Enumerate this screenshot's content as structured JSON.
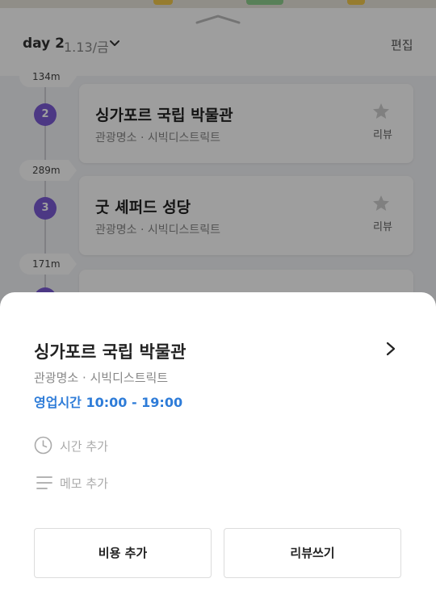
{
  "colors": {
    "accent_purple": "#7b5bd6",
    "hours_blue": "#2e7cd8",
    "overlay": "rgba(0,0,0,0.38)"
  },
  "header": {
    "day_label": "day 2",
    "date_label": "1.13/금",
    "edit_label": "편집",
    "dropdown_icon": "chevron-down-icon"
  },
  "itinerary": {
    "distances": [
      "134m",
      "289m",
      "171m"
    ],
    "places": [
      {
        "number": "2",
        "name": "싱가포르 국립 박물관",
        "meta": "관광명소 · 시빅디스트릭트",
        "review_label": "리뷰",
        "icon": "star-icon"
      },
      {
        "number": "3",
        "name": "굿 셰퍼드 성당",
        "meta": "관광명소 · 시빅디스트릭트",
        "review_label": "리뷰",
        "icon": "star-icon"
      }
    ]
  },
  "sheet": {
    "title": "싱가포르 국립 박물관",
    "meta": "관광명소 · 시빅디스트릭트",
    "hours": "영업시간 10:00 - 19:00",
    "add_time_label": "시간 추가",
    "add_memo_label": "메모 추가",
    "cost_button": "비용 추가",
    "review_button": "리뷰쓰기",
    "icons": [
      "chevron-right-icon",
      "clock-icon",
      "memo-lines-icon"
    ]
  }
}
